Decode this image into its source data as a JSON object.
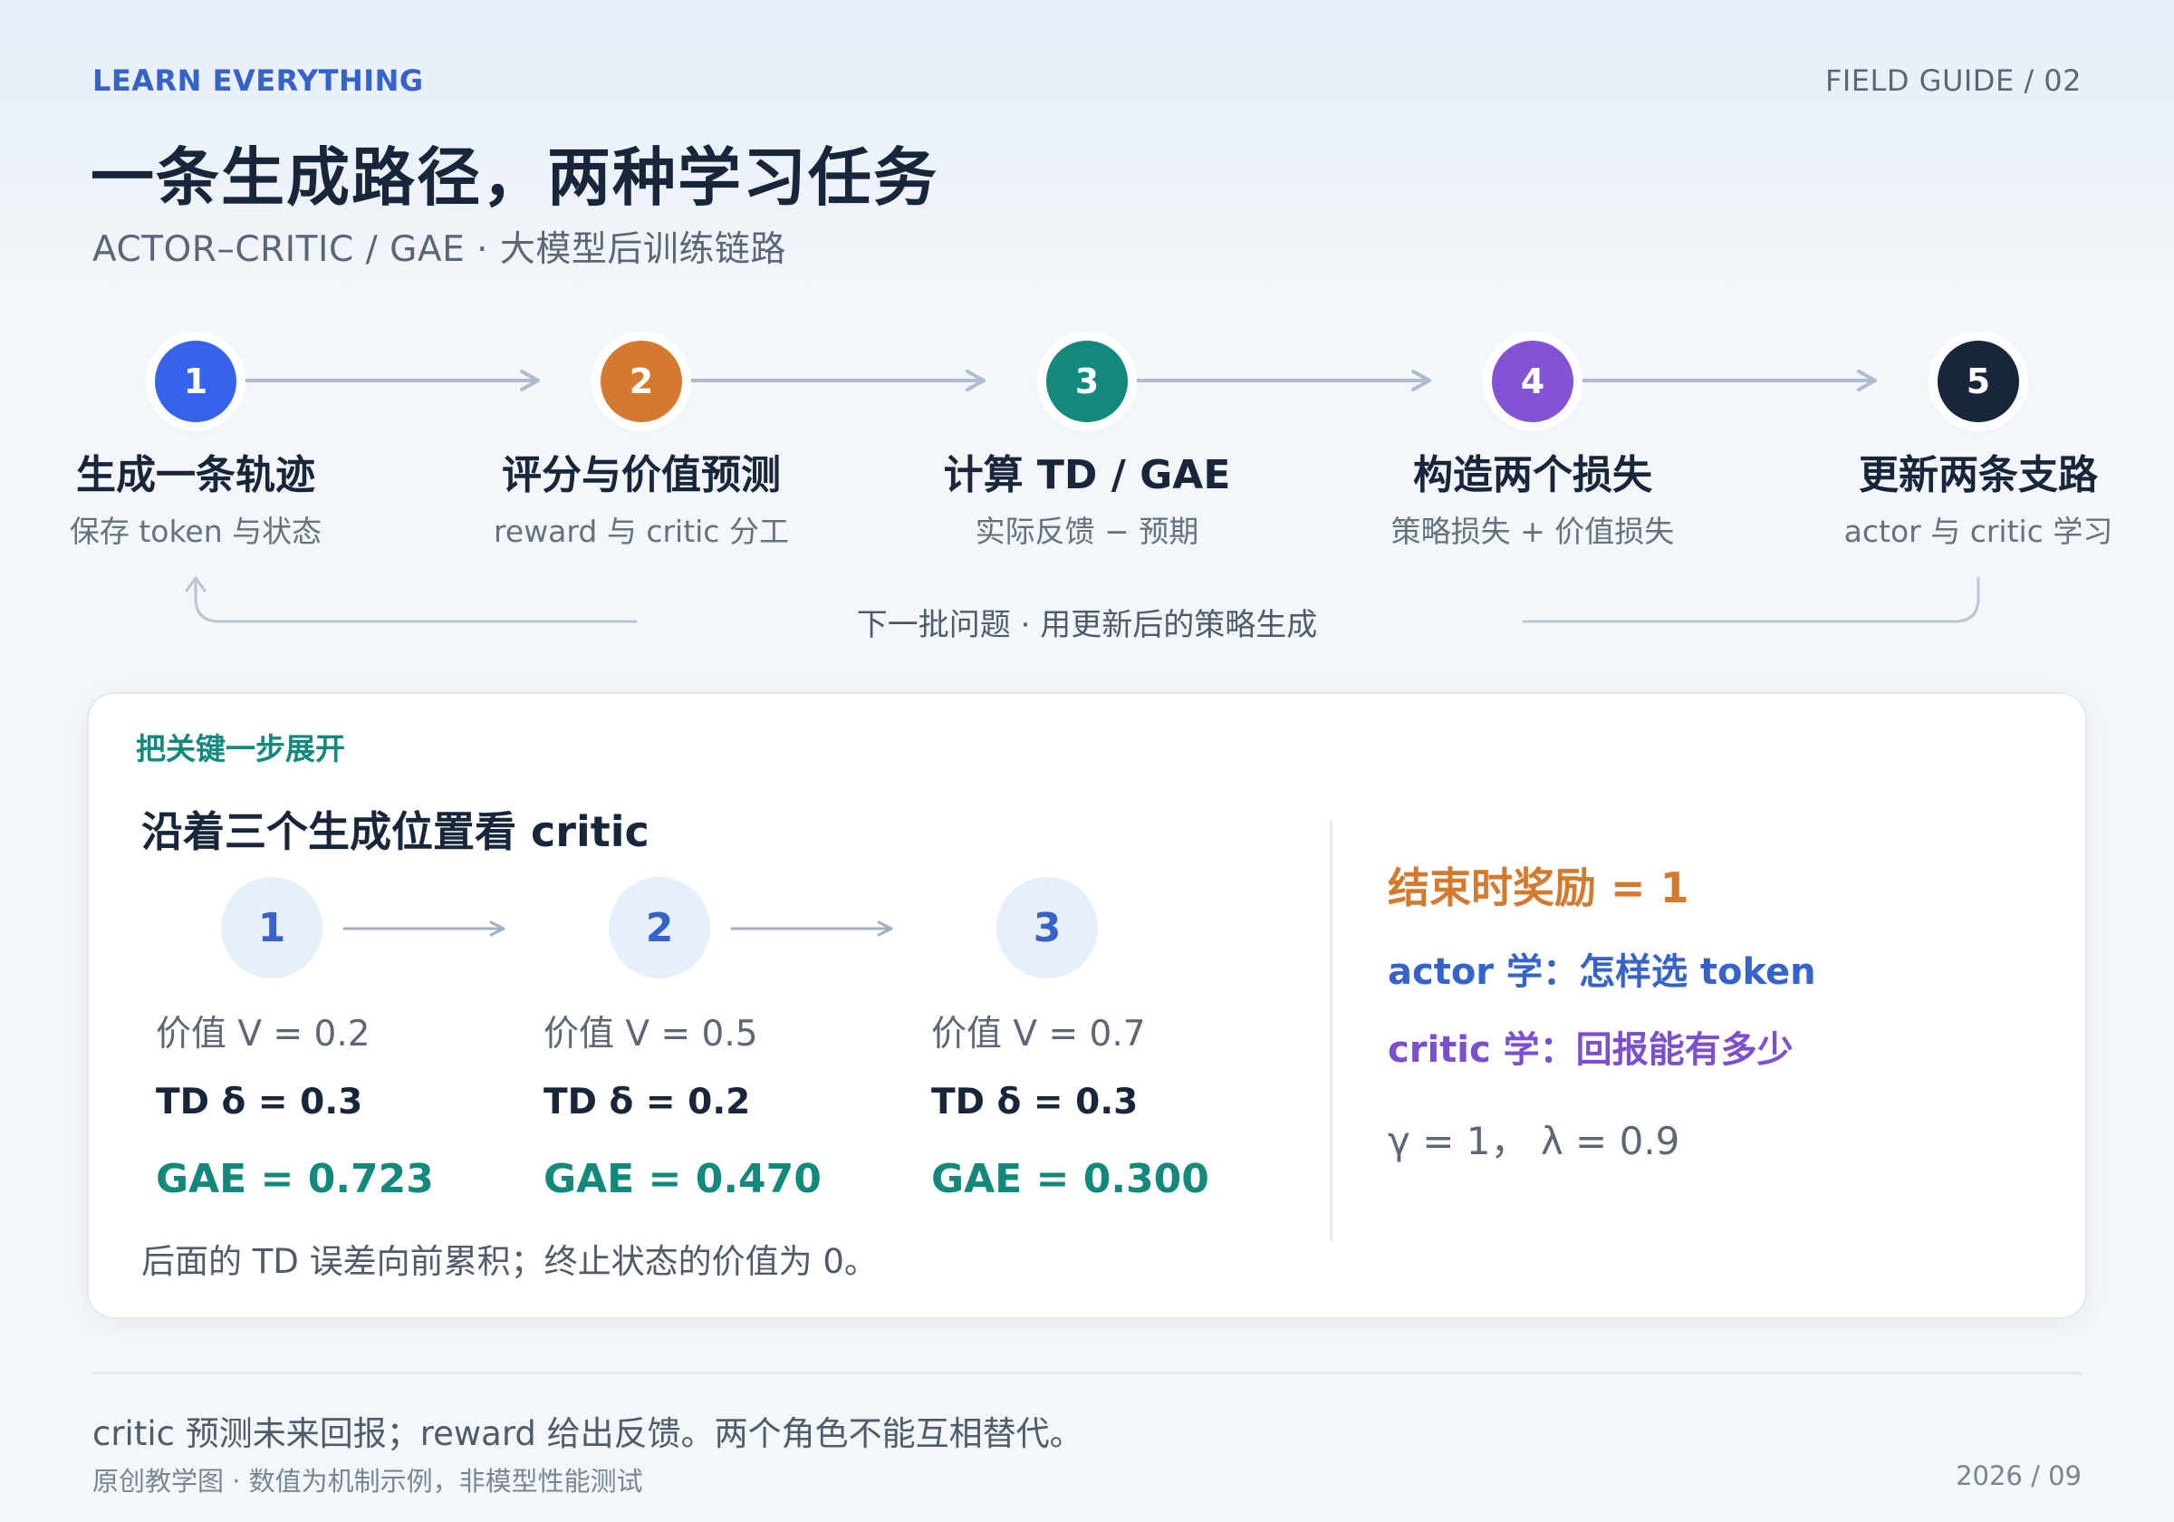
{
  "header": {
    "kicker": "LEARN EVERYTHING",
    "guide": "FIELD GUIDE / 02",
    "title": "一条生成路径，两种学习任务",
    "subtitle": "ACTOR–CRITIC / GAE · 大模型后训练链路"
  },
  "flow": {
    "steps": [
      {
        "num": "1",
        "title": "生成一条轨迹",
        "sub": "保存 token 与状态",
        "color": "#3563e9"
      },
      {
        "num": "2",
        "title": "评分与价值预测",
        "sub": "reward 与 critic 分工",
        "color": "#d47a2e"
      },
      {
        "num": "3",
        "title": "计算 TD / GAE",
        "sub": "实际反馈 − 预期",
        "color": "#12897c"
      },
      {
        "num": "4",
        "title": "构造两个损失",
        "sub": "策略损失 + 价值损失",
        "color": "#8452d4"
      },
      {
        "num": "5",
        "title": "更新两条支路",
        "sub": "actor 与 critic 学习",
        "color": "#17263a"
      }
    ],
    "loop_label": "下一批问题 · 用更新后的策略生成"
  },
  "card": {
    "kicker": "把关键一步展开",
    "title": "沿着三个生成位置看 critic",
    "positions": [
      {
        "num": "1",
        "value": "价值 V = 0.2",
        "td": "TD δ = 0.3",
        "gae": "GAE = 0.723"
      },
      {
        "num": "2",
        "value": "价值 V = 0.5",
        "td": "TD δ = 0.2",
        "gae": "GAE = 0.470"
      },
      {
        "num": "3",
        "value": "价值 V = 0.7",
        "td": "TD δ = 0.3",
        "gae": "GAE = 0.300"
      }
    ],
    "note": "后面的 TD 误差向前累积；终止状态的价值为 0。",
    "reward": "结束时奖励 = 1",
    "actor": "actor 学：怎样选 token",
    "critic": "critic 学：回报能有多少",
    "params": "γ = 1， λ = 0.9"
  },
  "footer": {
    "main": "critic 预测未来回报；reward 给出反馈。两个角色不能互相替代。",
    "note": "原创教学图 · 数值为机制示例，非模型性能测试",
    "date": "2026 / 09"
  }
}
